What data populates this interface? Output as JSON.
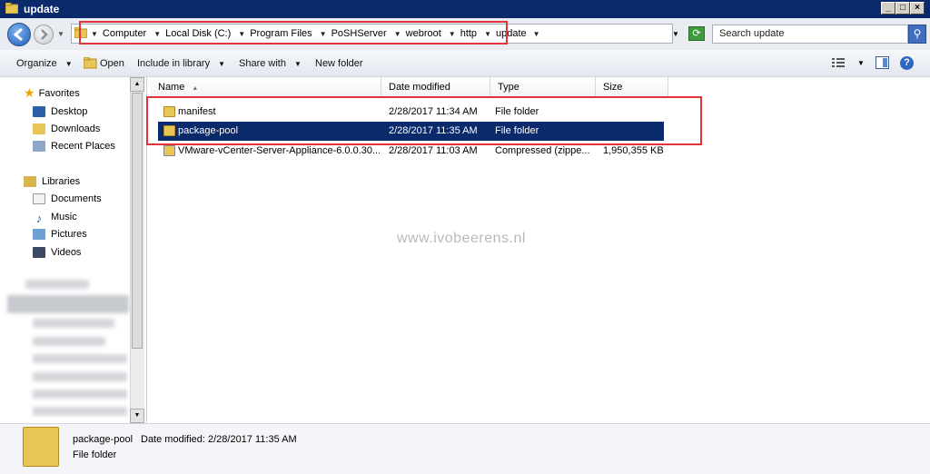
{
  "window": {
    "title": "update"
  },
  "address": {
    "crumbs": [
      "Computer",
      "Local Disk (C:)",
      "Program Files",
      "PoSHServer",
      "webroot",
      "http",
      "update"
    ],
    "search_placeholder": "Search update"
  },
  "toolbar": {
    "organize": "Organize",
    "open": "Open",
    "include_in_library": "Include in library",
    "share_with": "Share with",
    "new_folder": "New folder"
  },
  "nav": {
    "favorites_label": "Favorites",
    "favorites": [
      "Desktop",
      "Downloads",
      "Recent Places"
    ],
    "libraries_label": "Libraries",
    "libraries": [
      "Documents",
      "Music",
      "Pictures",
      "Videos"
    ]
  },
  "columns": {
    "name": "Name",
    "date": "Date modified",
    "type": "Type",
    "size": "Size"
  },
  "files": [
    {
      "name": "manifest",
      "date": "2/28/2017 11:34 AM",
      "type": "File folder",
      "size": ""
    },
    {
      "name": "package-pool",
      "date": "2/28/2017 11:35 AM",
      "type": "File folder",
      "size": ""
    },
    {
      "name": "VMware-vCenter-Server-Appliance-6.0.0.30...",
      "date": "2/28/2017 11:03 AM",
      "type": "Compressed (zippe...",
      "size": "1,950,355 KB"
    }
  ],
  "watermark": "www.ivobeerens.nl",
  "details": {
    "name": "package-pool",
    "meta": "Date modified: 2/28/2017 11:35 AM",
    "type": "File folder"
  },
  "colors": {
    "titlebar": "#0b2a6b",
    "selection": "#0b2a6b",
    "highlight": "#e0333b"
  }
}
